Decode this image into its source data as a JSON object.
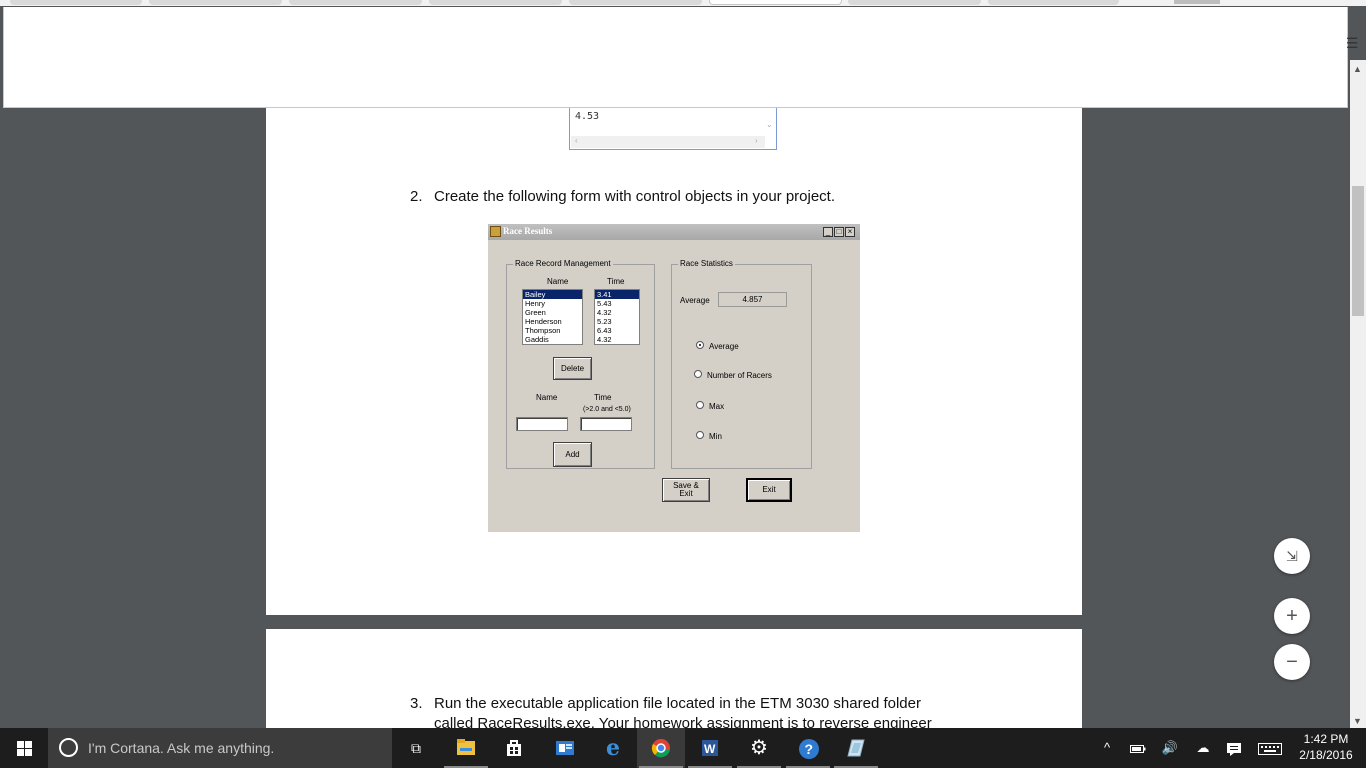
{
  "document": {
    "prev_output_value": "4.53",
    "step2": {
      "number": "2.",
      "text": "Create the following form with control objects in your project."
    },
    "step3": {
      "number": "3.",
      "text": "Run the executable application file located in the ETM 3030 shared folder",
      "text_line2": "called RaceResults.exe.  Your homework assignment is to reverse engineer"
    }
  },
  "race_form": {
    "title": "Race Results",
    "window_buttons": [
      "_",
      "□",
      "×"
    ],
    "management_group": "Race Record Management",
    "name_header": "Name",
    "time_header": "Time",
    "names": [
      "Bailey",
      "Henry",
      "Green",
      "Henderson",
      "Thompson",
      "Gaddis"
    ],
    "times": [
      "3.41",
      "5.43",
      "4.32",
      "5.23",
      "6.43",
      "4.32"
    ],
    "delete_label": "Delete",
    "name_label": "Name",
    "time_label": "Time",
    "time_hint": "(>2.0 and <5.0)",
    "add_label": "Add",
    "stats_group": "Race Statistics",
    "average_label": "Average",
    "average_value": "4.857",
    "radio_options": [
      "Average",
      "Number of Racers",
      "Max",
      "Min"
    ],
    "save_exit_label_1": "Save &",
    "save_exit_label_2": "Exit",
    "exit_label": "Exit"
  },
  "zoom": {
    "fit": "⇲",
    "in": "+",
    "out": "−"
  },
  "taskbar": {
    "cortana_placeholder": "I'm Cortana. Ask me anything.",
    "icons": [
      "task-view-icon",
      "file-explorer-icon",
      "store-icon",
      "outlook-icon",
      "edge-icon",
      "chrome-icon",
      "word-icon",
      "settings-icon",
      "help-icon",
      "app-icon"
    ],
    "time": "1:42 PM",
    "date": "2/18/2016"
  }
}
